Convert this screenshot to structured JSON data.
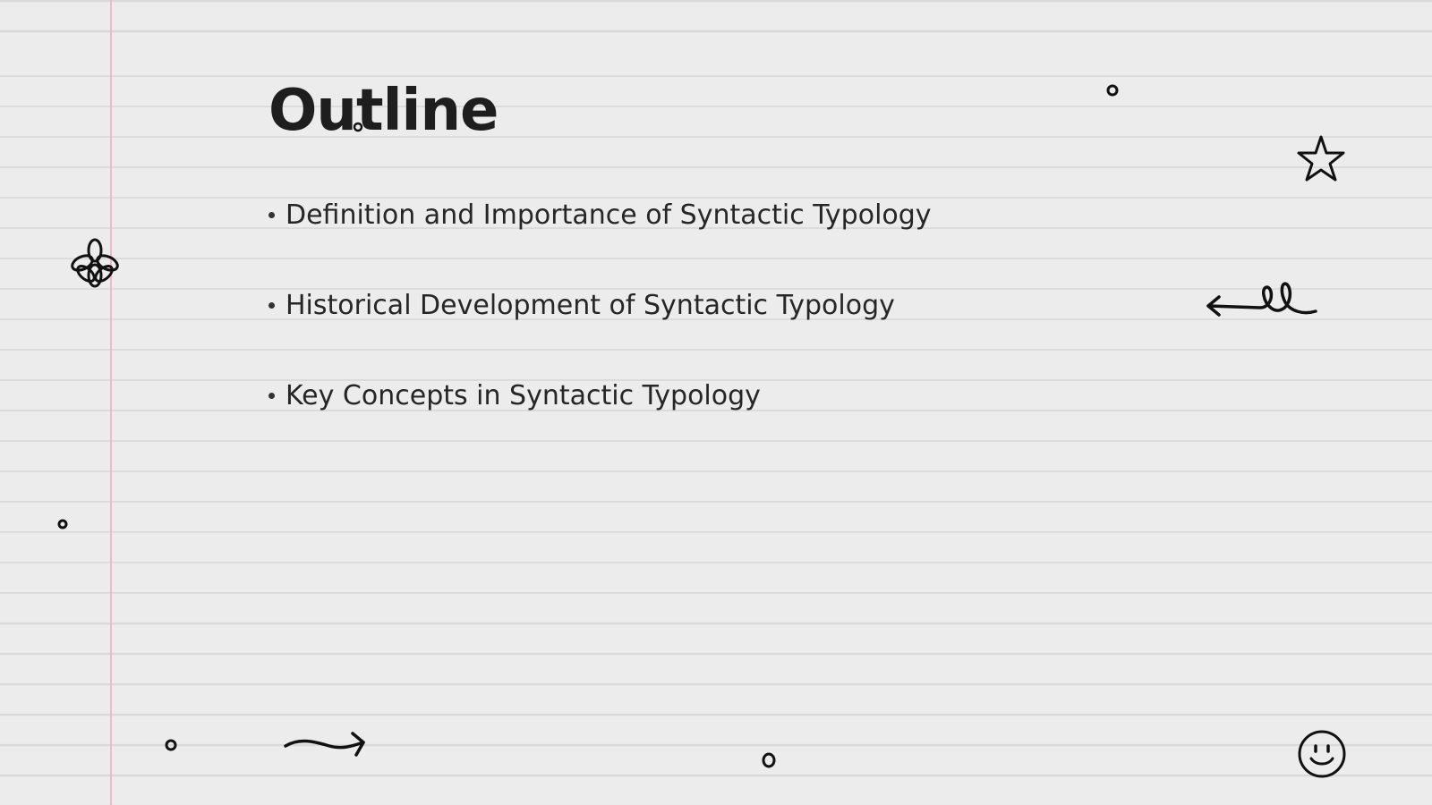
{
  "slide": {
    "title": "Outline",
    "bullets": [
      "Definition and Importance of Syntactic Typology",
      "Historical Development of Syntactic Typology",
      "Key Concepts in Syntactic Typology"
    ]
  },
  "theme": {
    "background": "#ececec",
    "ruled_line_color": "#d9d9d9",
    "margin_line_color": "#f7b6c8",
    "ink_color": "#1e1e1e"
  },
  "doodles": {
    "icons": [
      "flower-icon",
      "star-icon",
      "squiggle-arrow-left-icon",
      "arrow-right-icon",
      "smiley-icon",
      "circle-icon"
    ]
  }
}
